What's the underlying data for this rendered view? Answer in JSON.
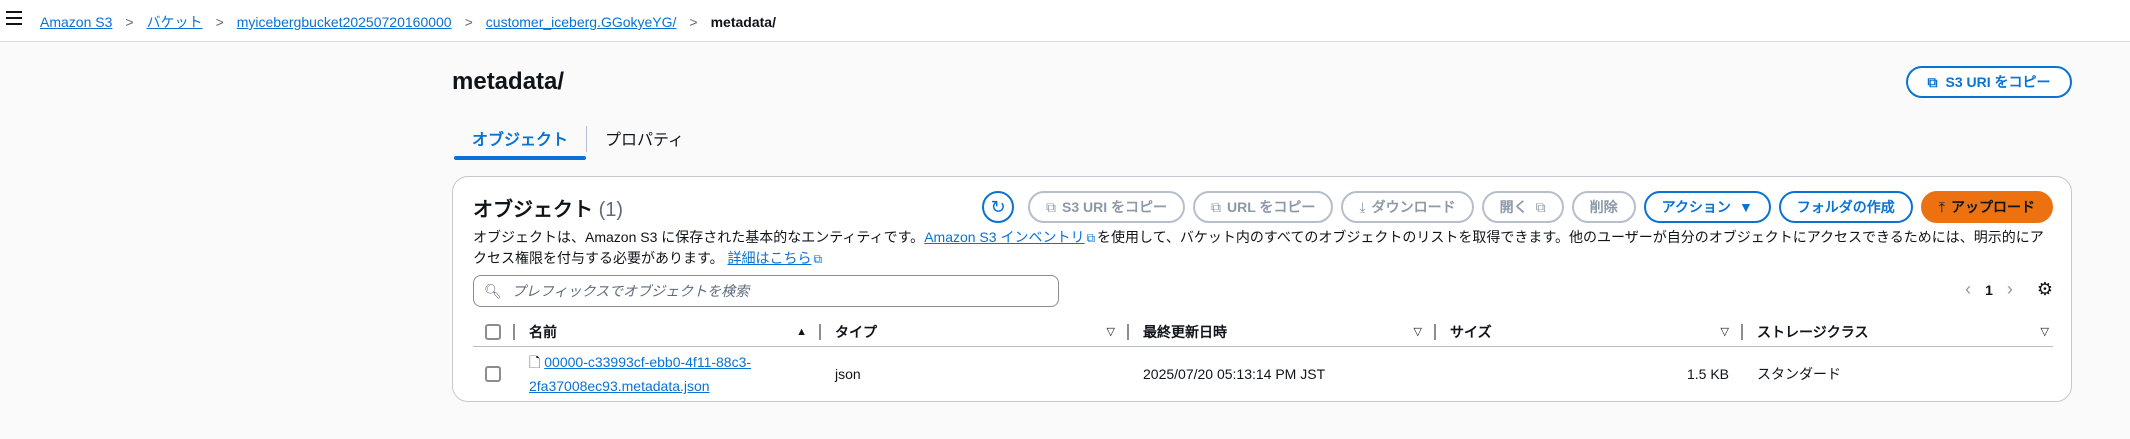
{
  "breadcrumb": {
    "items": [
      "Amazon S3",
      "バケット",
      "myicebergbucket20250720160000",
      "customer_iceberg.GGokyeYG/"
    ],
    "current": "metadata/",
    "separator": ">"
  },
  "page": {
    "title": "metadata/",
    "copy_uri_label": "S3 URI をコピー"
  },
  "tabs": [
    {
      "label": "オブジェクト",
      "active": true
    },
    {
      "label": "プロパティ",
      "active": false
    }
  ],
  "objects": {
    "title": "オブジェクト",
    "count": "(1)",
    "toolbar": {
      "copy_s3_uri": "S3 URI をコピー",
      "copy_url": "URL をコピー",
      "download": "ダウンロード",
      "open": "開く",
      "delete": "削除",
      "actions": "アクション",
      "create_folder": "フォルダの作成",
      "upload": "アップロード"
    },
    "description": {
      "part1": "オブジェクトは、Amazon S3 に保存された基本的なエンティティです。",
      "inventory_link": "Amazon S3 インベントリ",
      "part2": "を使用して、バケット内のすべてのオブジェクトのリストを取得できます。他のユーザーが自分のオブジェクトにアクセスできるためには、明示的にアクセス権限を付与する必要があります。",
      "learn_more": "詳細はこちら"
    },
    "search_placeholder": "プレフィックスでオブジェクトを検索",
    "page_number": "1",
    "columns": [
      "名前",
      "タイプ",
      "最終更新日時",
      "サイズ",
      "ストレージクラス"
    ],
    "rows": [
      {
        "name_line1": "00000-c33993cf-ebb0-4f11-88c3-",
        "name_line2": "2fa37008ec93.metadata.json",
        "type": "json",
        "last_modified": "2025/07/20 05:13:14 PM JST",
        "size": "1.5 KB",
        "storage_class": "スタンダード"
      }
    ]
  },
  "colors": {
    "link": "#0972d3",
    "upload_button": "#ec7211",
    "disabled": "#8d99a8"
  }
}
